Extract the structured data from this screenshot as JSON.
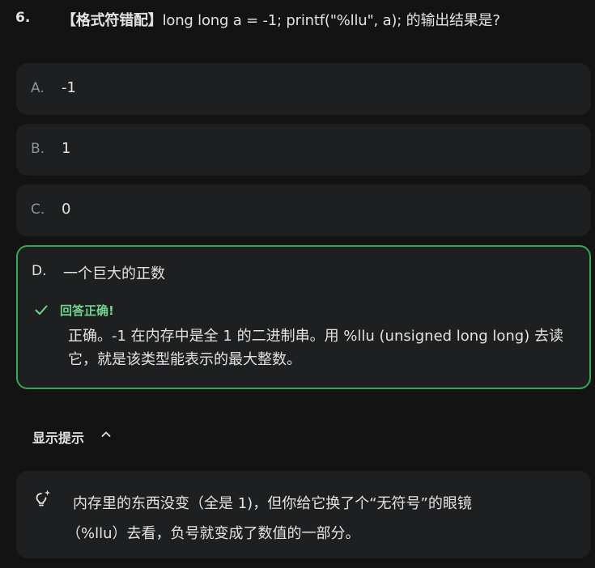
{
  "question": {
    "number": "6.",
    "tag": "【格式符错配】",
    "text": "long long a = -1; printf(\"%llu\", a); 的输出结果是?"
  },
  "options": [
    {
      "letter": "A.",
      "text": "-1"
    },
    {
      "letter": "B.",
      "text": "1"
    },
    {
      "letter": "C.",
      "text": "0"
    },
    {
      "letter": "D.",
      "text": "一个巨大的正数"
    }
  ],
  "feedback": {
    "icon": "check-icon",
    "title": "回答正确!",
    "body": "正确。-1 在内存中是全 1 的二进制串。用 %llu (unsigned long long) 去读它，就是该类型能表示的最大整数。"
  },
  "hint": {
    "toggle_label": "显示提示",
    "toggle_icon": "chevron-up-icon",
    "icon": "lightbulb-icon",
    "line1": "内存里的东西没变（全是 1)，但你给它换了个“无符号”的眼镜",
    "line2": "（%llu）去看，负号就变成了数值的一部分。"
  },
  "colors": {
    "background": "#131314",
    "card": "#1e1f20",
    "correct_border": "#34a853",
    "correct_text": "#6dd58c",
    "muted_letter": "#8e9094"
  }
}
